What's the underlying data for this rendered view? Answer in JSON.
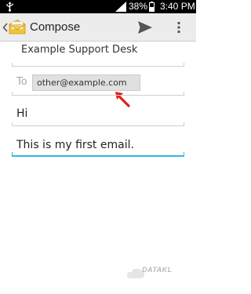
{
  "status_bar": {
    "battery_percent": "38%",
    "time": "3:40 PM",
    "icons": [
      "usb-icon",
      "signal-icon",
      "battery-icon"
    ]
  },
  "action_bar": {
    "title": "Compose",
    "icons": [
      "back-chevron-icon",
      "mail-app-icon",
      "send-icon",
      "overflow-menu-icon"
    ]
  },
  "compose": {
    "from_account": "Example Support Desk",
    "to_label": "To",
    "to_recipient": "other@example.com",
    "subject": "Hi",
    "body": "This is my first email."
  },
  "watermark": {
    "brand_text": "DATAKL"
  },
  "colors": {
    "status_bar_bg": "#000000",
    "action_bar_bg": "#ececec",
    "focus_underline": "#33b5e5",
    "annotation_arrow": "#e02020"
  }
}
